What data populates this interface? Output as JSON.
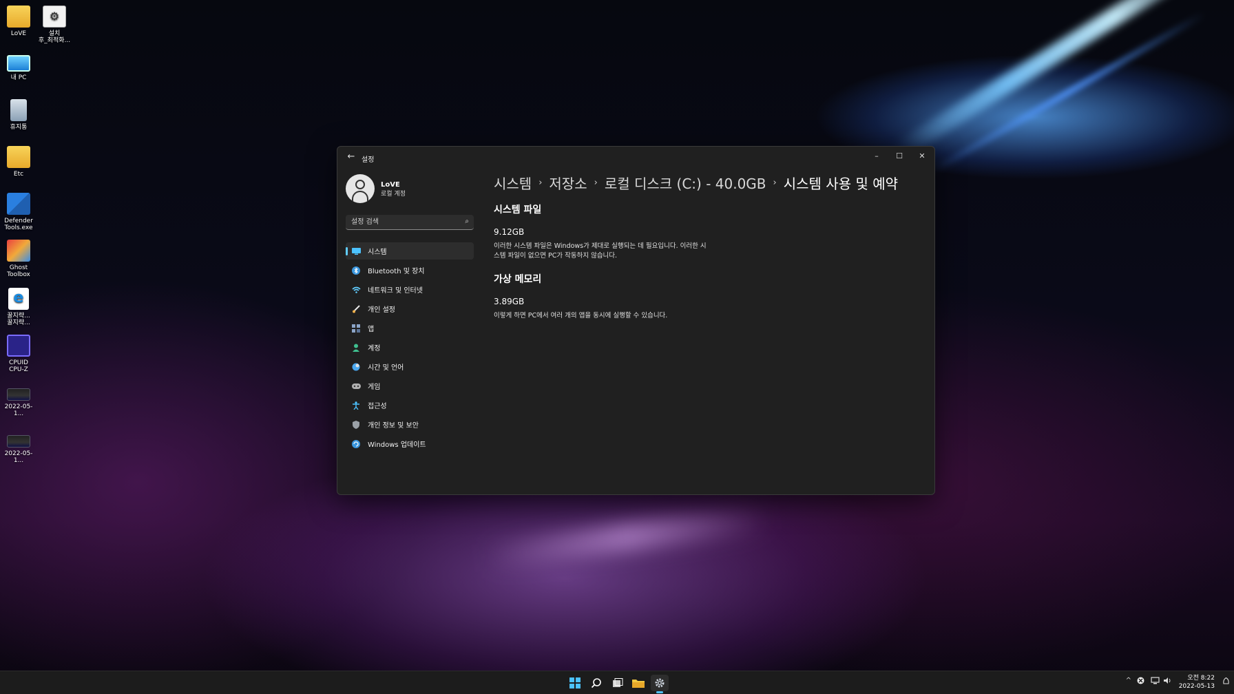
{
  "desktop": {
    "icons": [
      {
        "label": "LoVE"
      },
      {
        "label": "설치\n후_최적화..."
      },
      {
        "label": "내 PC"
      },
      {
        "label": "휴지통"
      },
      {
        "label": "Etc"
      },
      {
        "label": "Defender\nTools.exe"
      },
      {
        "label": "Ghost\nToolbox"
      },
      {
        "label": "꿀지략...\n꿀지략..."
      },
      {
        "label": "CPUID\nCPU-Z"
      },
      {
        "label": "2022-05-1..."
      },
      {
        "label": "2022-05-1..."
      }
    ]
  },
  "window": {
    "title": "설정",
    "controls": {
      "minimize": "–",
      "maximize": "☐",
      "close": "✕"
    },
    "back": "←"
  },
  "profile": {
    "name": "LoVE",
    "account_type": "로컬 계정"
  },
  "search": {
    "placeholder": "설정 검색"
  },
  "nav": {
    "items": [
      {
        "label": "시스템",
        "icon": "display-icon",
        "color": "#4cc2ff",
        "active": true
      },
      {
        "label": "Bluetooth 및 장치",
        "icon": "bluetooth-icon",
        "color": "#3a96dd"
      },
      {
        "label": "네트워크 및 인터넷",
        "icon": "wifi-icon",
        "color": "#60cdff"
      },
      {
        "label": "개인 설정",
        "icon": "brush-icon",
        "color": "#f7b24a"
      },
      {
        "label": "앱",
        "icon": "apps-icon",
        "color": "#8ca5c8"
      },
      {
        "label": "계정",
        "icon": "person-icon",
        "color": "#3fbf8f"
      },
      {
        "label": "시간 및 언어",
        "icon": "globe-clock-icon",
        "color": "#4aa8f0"
      },
      {
        "label": "게임",
        "icon": "gamepad-icon",
        "color": "#b0b0b0"
      },
      {
        "label": "접근성",
        "icon": "accessibility-icon",
        "color": "#4cc2ff"
      },
      {
        "label": "개인 정보 및 보안",
        "icon": "shield-icon",
        "color": "#9aa0a6"
      },
      {
        "label": "Windows 업데이트",
        "icon": "update-icon",
        "color": "#3a96dd"
      }
    ]
  },
  "breadcrumb": {
    "items": [
      "시스템",
      "저장소",
      "로컬 디스크 (C:) - 40.0GB",
      "시스템 사용 및 예약"
    ],
    "separator": "›"
  },
  "sections": {
    "system_files": {
      "title": "시스템 파일",
      "size": "9.12GB",
      "description": "이러한 시스템 파일은 Windows가 제대로 실행되는 데 필요입니다. 이러한 시스템 파일이 없으면 PC가 작동하지 않습니다."
    },
    "virtual_memory": {
      "title": "가상 메모리",
      "size": "3.89GB",
      "description": "이렇게 하면 PC에서 여러 개의 앱을 동시에 실행할 수 있습니다."
    }
  },
  "taskbar": {
    "clock": {
      "time": "오전 8:22",
      "date": "2022-05-13"
    },
    "tray": {
      "chevron": "^"
    }
  }
}
